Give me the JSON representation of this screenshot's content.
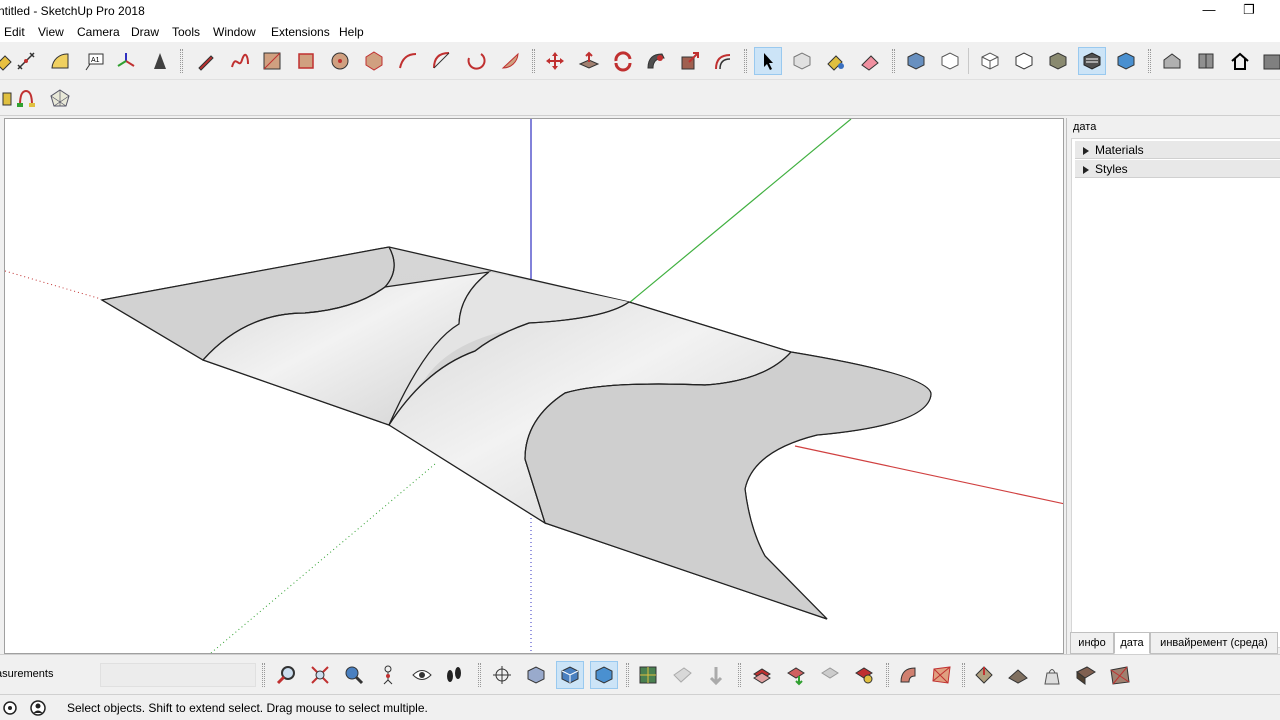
{
  "window": {
    "title": "ntitled - SketchUp Pro 2018",
    "minimize_glyph": "—",
    "restore_glyph": "❐"
  },
  "menu": {
    "items": [
      "Edit",
      "View",
      "Camera",
      "Draw",
      "Tools",
      "Window",
      "Extensions",
      "Help"
    ]
  },
  "tray": {
    "title": "дата",
    "panels": [
      "Materials",
      "Styles"
    ],
    "tabs": [
      "инфо",
      "дата",
      "инвайремент (среда)"
    ],
    "active_tab": "дата"
  },
  "measurements": {
    "label": "asurements",
    "value": ""
  },
  "status": {
    "text": "Select objects. Shift to extend select. Drag mouse to select multiple."
  },
  "colors": {
    "axis_red": "#d04040",
    "axis_green": "#40b040",
    "axis_blue": "#3030c0",
    "surface": "#d4d4d4",
    "selection_highlight": "#cce4f7"
  },
  "icons": {
    "toolbar_main": [
      "paint-bucket-icon",
      "dimension-icon",
      "protractor-icon",
      "text-icon",
      "axes-icon",
      "3d-text-icon",
      "pencil-icon",
      "freehand-icon",
      "rectangle-icon",
      "rotated-rectangle-icon",
      "circle-icon",
      "polygon-icon",
      "arc-icon",
      "two-point-arc-icon",
      "three-point-arc-icon",
      "pie-icon",
      "move-icon",
      "push-pull-icon",
      "rotate-icon",
      "follow-me-icon",
      "scale-icon",
      "offset-icon",
      "select-icon",
      "make-component-icon",
      "paint-icon",
      "eraser-icon",
      "iso-view-icon",
      "top-view-icon",
      "front-view-icon",
      "right-view-icon",
      "back-view-icon",
      "left-view-icon",
      "bottom-view-icon",
      "warehouse-icon",
      "extension-warehouse-icon",
      "home-icon",
      "more-icon"
    ],
    "toolbar_bottom": [
      "zoom-icon",
      "zoom-extents-icon",
      "zoom-window-icon",
      "position-camera-icon",
      "look-around-icon",
      "walk-icon",
      "section-plane-icon",
      "xray-icon",
      "back-edges-icon",
      "wireframe-icon",
      "hidden-line-icon",
      "shaded-icon",
      "sandbox-from-contours-icon",
      "sandbox-from-scratch-icon",
      "smoove-icon",
      "stamp-icon",
      "drape-icon",
      "add-detail-icon",
      "flip-edge-icon"
    ]
  }
}
